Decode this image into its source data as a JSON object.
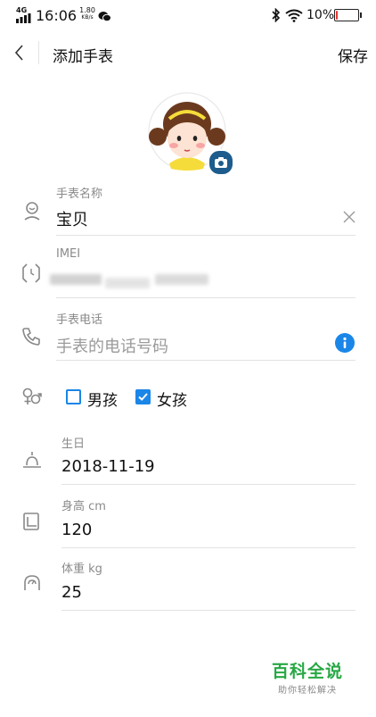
{
  "status_bar": {
    "network": "4G",
    "time": "16:06",
    "speed_value": "1.80",
    "speed_unit": "KB/s",
    "battery": "10%",
    "battery_level": 0.1,
    "icons": [
      "signal-icon",
      "wechat-icon",
      "bluetooth-icon",
      "wifi-icon",
      "battery-icon"
    ]
  },
  "header": {
    "title": "添加手表",
    "save_label": "保存"
  },
  "form": {
    "watch_name": {
      "label": "手表名称",
      "value": "宝贝"
    },
    "imei": {
      "label": "IMEI"
    },
    "watch_phone": {
      "label": "手表电话",
      "placeholder": "手表的电话号码"
    },
    "gender": {
      "options": [
        {
          "label": "男孩",
          "checked": false
        },
        {
          "label": "女孩",
          "checked": true
        }
      ]
    },
    "birthday": {
      "label": "生日",
      "value": "2018-11-19"
    },
    "height": {
      "label": "身高 cm",
      "value": "120"
    },
    "weight": {
      "label": "体重 kg",
      "value": "25"
    }
  },
  "watermark": {
    "main": "百科全说",
    "sub": "助你轻松解决"
  },
  "colors": {
    "accent": "#1a86e8",
    "battery_low": "#e53935",
    "watermark": "#27a844"
  }
}
